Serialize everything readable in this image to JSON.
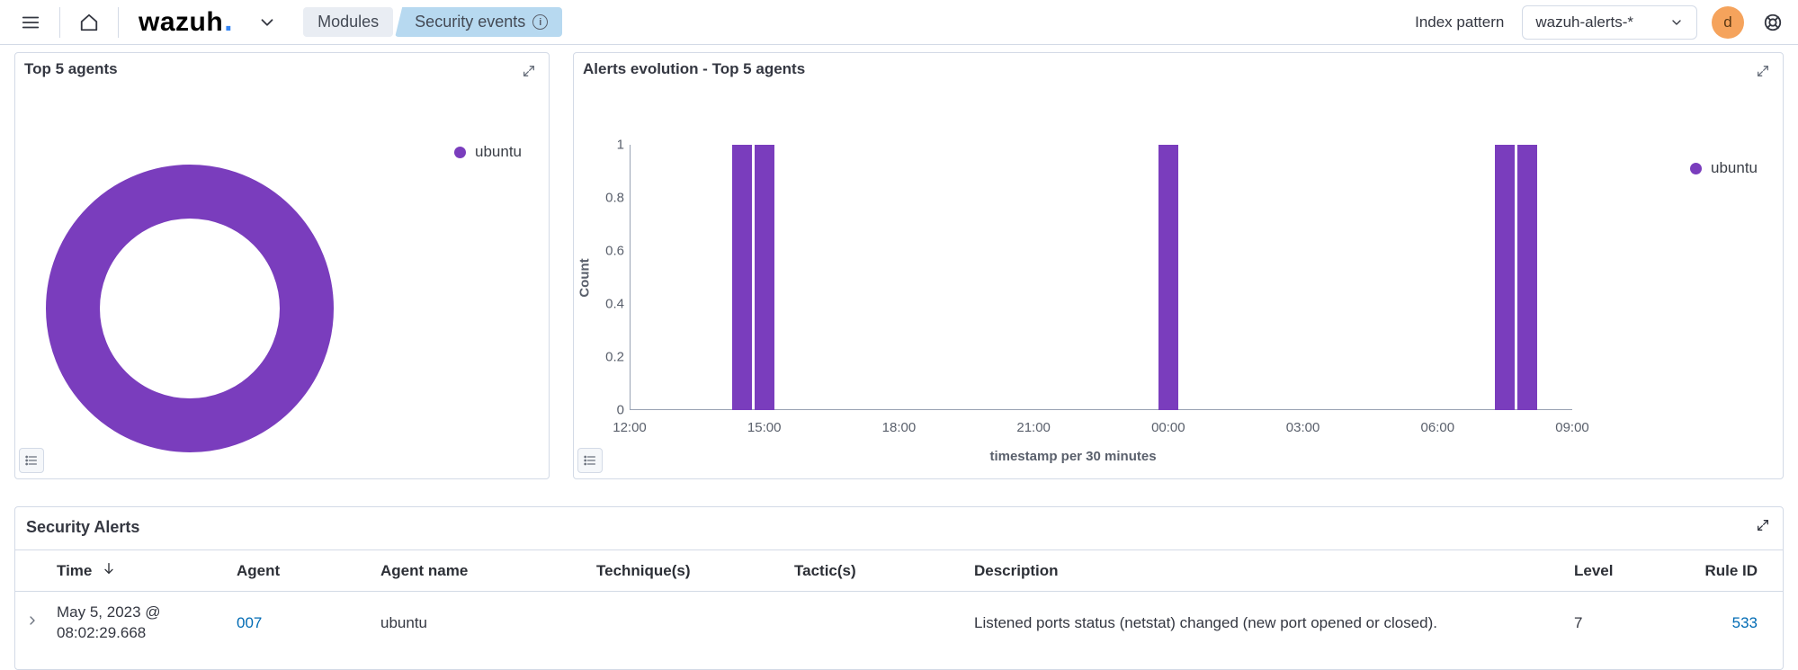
{
  "header": {
    "logo_text": "wazuh",
    "modules_label": "Modules",
    "breadcrumb_current": "Security events",
    "index_pattern_label": "Index pattern",
    "index_pattern_value": "wazuh-alerts-*",
    "avatar_letter": "d"
  },
  "panels": {
    "top5_title": "Top 5 agents",
    "top5_legend": "ubuntu",
    "evolution_title": "Alerts evolution - Top 5 agents",
    "evolution_legend": "ubuntu"
  },
  "chart_data": [
    {
      "type": "pie",
      "title": "Top 5 agents",
      "series": [
        {
          "name": "ubuntu",
          "value": 1.0
        }
      ]
    },
    {
      "type": "bar",
      "title": "Alerts evolution - Top 5 agents",
      "xlabel": "timestamp per 30 minutes",
      "ylabel": "Count",
      "ylim": [
        0,
        1
      ],
      "yticks": [
        0,
        0.2,
        0.4,
        0.6,
        0.8,
        1
      ],
      "xticks": [
        "12:00",
        "15:00",
        "18:00",
        "21:00",
        "00:00",
        "03:00",
        "06:00",
        "09:00"
      ],
      "series": [
        {
          "name": "ubuntu",
          "bars": [
            {
              "x": "14:30",
              "value": 1
            },
            {
              "x": "15:00",
              "value": 1
            },
            {
              "x": "00:00",
              "value": 1
            },
            {
              "x": "07:30",
              "value": 1
            },
            {
              "x": "08:00",
              "value": 1
            }
          ]
        }
      ]
    }
  ],
  "alerts": {
    "title": "Security Alerts",
    "columns": {
      "time": "Time",
      "agent": "Agent",
      "agent_name": "Agent name",
      "techniques": "Technique(s)",
      "tactics": "Tactic(s)",
      "description": "Description",
      "level": "Level",
      "rule_id": "Rule ID"
    },
    "rows": [
      {
        "time": "May 5, 2023 @ 08:02:29.668",
        "agent": "007",
        "agent_name": "ubuntu",
        "techniques": "",
        "tactics": "",
        "description": "Listened ports status (netstat) changed (new port opened or closed).",
        "level": "7",
        "rule_id": "533"
      }
    ]
  }
}
